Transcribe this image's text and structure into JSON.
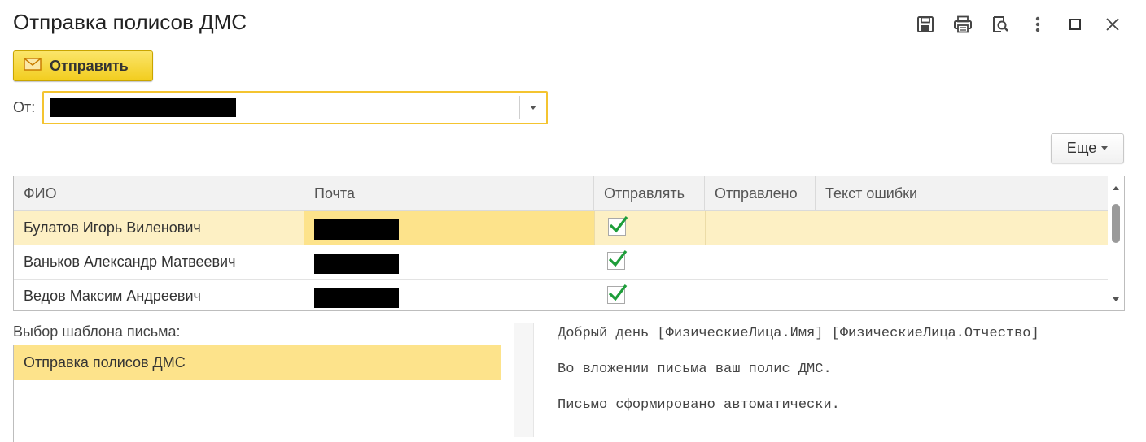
{
  "window": {
    "title": "Отправка полисов ДМС",
    "tools": [
      "save-icon",
      "print-icon",
      "preview-icon",
      "more-vertical-icon",
      "maximize-icon",
      "close-icon"
    ]
  },
  "toolbar": {
    "send_label": "Отправить",
    "send_icon": "envelope-icon"
  },
  "from": {
    "label": "От:",
    "value_redacted": true
  },
  "more_button": {
    "label": "Еще"
  },
  "table": {
    "columns": [
      "ФИО",
      "Почта",
      "Отправлять",
      "Отправлено",
      "Текст ошибки"
    ],
    "rows": [
      {
        "fio": "Булатов Игорь Виленович",
        "email_redacted": true,
        "send": true,
        "sent": "",
        "error": "",
        "selected": true
      },
      {
        "fio": "Ваньков Александр Матвеевич",
        "email_redacted": true,
        "send": true,
        "sent": "",
        "error": "",
        "selected": false
      },
      {
        "fio": "Ведов Максим Андреевич",
        "email_redacted": true,
        "send": true,
        "sent": "",
        "error": "",
        "selected": false
      }
    ]
  },
  "template": {
    "label": "Выбор шаблона письма:",
    "items": [
      "Отправка полисов ДМС"
    ]
  },
  "preview": {
    "line1": "Добрый день [ФизическиеЛица.Имя] [ФизическиеЛица.Отчество]",
    "line2": "Во вложении письма ваш полис ДМС.",
    "line3": "Письмо сформировано автоматически."
  },
  "colors": {
    "accent_yellow": "#f2cd1e",
    "selection": "#fde38b",
    "row_highlight": "#fdf0c4",
    "check_green": "#1e9e3a"
  }
}
